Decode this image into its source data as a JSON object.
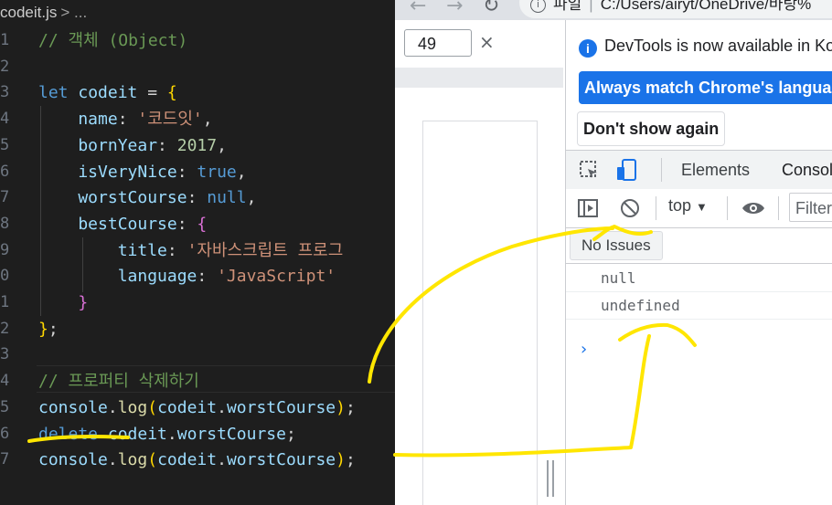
{
  "editor": {
    "breadcrumb": "codeit.js",
    "breadcrumb_tail": "> ...",
    "line_numbers": [
      "1",
      "2",
      "3",
      "4",
      "5",
      "6",
      "7",
      "8",
      "9",
      "0",
      "1",
      "2",
      "3",
      "4",
      "5",
      "6",
      "7"
    ],
    "lines": [
      {
        "segs": [
          {
            "t": "// 객체 (Object)",
            "c": "c"
          }
        ]
      },
      {
        "segs": []
      },
      {
        "segs": [
          {
            "t": "let",
            "c": "k"
          },
          {
            "t": " ",
            "c": "p"
          },
          {
            "t": "codeit",
            "c": "v"
          },
          {
            "t": " = ",
            "c": "p"
          },
          {
            "t": "{",
            "c": "b1"
          }
        ]
      },
      {
        "segs": [
          {
            "t": "    name",
            "c": "v"
          },
          {
            "t": ": ",
            "c": "p"
          },
          {
            "t": "'코드잇'",
            "c": "s"
          },
          {
            "t": ",",
            "c": "p"
          }
        ]
      },
      {
        "segs": [
          {
            "t": "    bornYear",
            "c": "v"
          },
          {
            "t": ": ",
            "c": "p"
          },
          {
            "t": "2017",
            "c": "n"
          },
          {
            "t": ",",
            "c": "p"
          }
        ]
      },
      {
        "segs": [
          {
            "t": "    isVeryNice",
            "c": "v"
          },
          {
            "t": ": ",
            "c": "p"
          },
          {
            "t": "true",
            "c": "k"
          },
          {
            "t": ",",
            "c": "p"
          }
        ]
      },
      {
        "segs": [
          {
            "t": "    worstCourse",
            "c": "v"
          },
          {
            "t": ": ",
            "c": "p"
          },
          {
            "t": "null",
            "c": "k"
          },
          {
            "t": ",",
            "c": "p"
          }
        ]
      },
      {
        "segs": [
          {
            "t": "    bestCourse",
            "c": "v"
          },
          {
            "t": ": ",
            "c": "p"
          },
          {
            "t": "{",
            "c": "b2"
          }
        ]
      },
      {
        "segs": [
          {
            "t": "        title",
            "c": "v"
          },
          {
            "t": ": ",
            "c": "p"
          },
          {
            "t": "'자바스크립트 프로그",
            "c": "s"
          }
        ]
      },
      {
        "segs": [
          {
            "t": "        language",
            "c": "v"
          },
          {
            "t": ": ",
            "c": "p"
          },
          {
            "t": "'JavaScript'",
            "c": "s"
          }
        ]
      },
      {
        "segs": [
          {
            "t": "    }",
            "c": "b2"
          }
        ]
      },
      {
        "segs": [
          {
            "t": "}",
            "c": "b1"
          },
          {
            "t": ";",
            "c": "p"
          }
        ]
      },
      {
        "segs": []
      },
      {
        "segs": [
          {
            "t": "// 프로퍼티 삭제하기",
            "c": "c"
          }
        ]
      },
      {
        "segs": [
          {
            "t": "console",
            "c": "v"
          },
          {
            "t": ".",
            "c": "p"
          },
          {
            "t": "log",
            "c": "f"
          },
          {
            "t": "(",
            "c": "b1"
          },
          {
            "t": "codeit",
            "c": "v"
          },
          {
            "t": ".",
            "c": "p"
          },
          {
            "t": "worstCourse",
            "c": "v"
          },
          {
            "t": ")",
            "c": "b1"
          },
          {
            "t": ";",
            "c": "p"
          }
        ]
      },
      {
        "segs": [
          {
            "t": "delete",
            "c": "k"
          },
          {
            "t": " ",
            "c": "p"
          },
          {
            "t": "codeit",
            "c": "v"
          },
          {
            "t": ".",
            "c": "p"
          },
          {
            "t": "worstCourse",
            "c": "v"
          },
          {
            "t": ";",
            "c": "p"
          }
        ]
      },
      {
        "segs": [
          {
            "t": "console",
            "c": "v"
          },
          {
            "t": ".",
            "c": "p"
          },
          {
            "t": "log",
            "c": "f"
          },
          {
            "t": "(",
            "c": "b1"
          },
          {
            "t": "codeit",
            "c": "v"
          },
          {
            "t": ".",
            "c": "p"
          },
          {
            "t": "worstCourse",
            "c": "v"
          },
          {
            "t": ")",
            "c": "b1"
          },
          {
            "t": ";",
            "c": "p"
          }
        ]
      }
    ]
  },
  "browser": {
    "url_prefix": "파일",
    "url": "C:/Users/airyt/OneDrive/바탕%",
    "find_value": "49",
    "find_close": "×"
  },
  "devtools": {
    "notice": "DevTools is now available in Ko",
    "notice_icon": "i",
    "primary_button": "Always match Chrome's language",
    "secondary_button": "Don't show again",
    "tabs": [
      {
        "label": "Elements"
      },
      {
        "label": "Console"
      }
    ],
    "context": "top",
    "filter_placeholder": "Filter",
    "issues_button": "No Issues",
    "console_lines": [
      "null",
      "undefined"
    ],
    "prompt": "›"
  },
  "colors": {
    "annotation": "#ffe600",
    "accent": "#1a73e8"
  }
}
